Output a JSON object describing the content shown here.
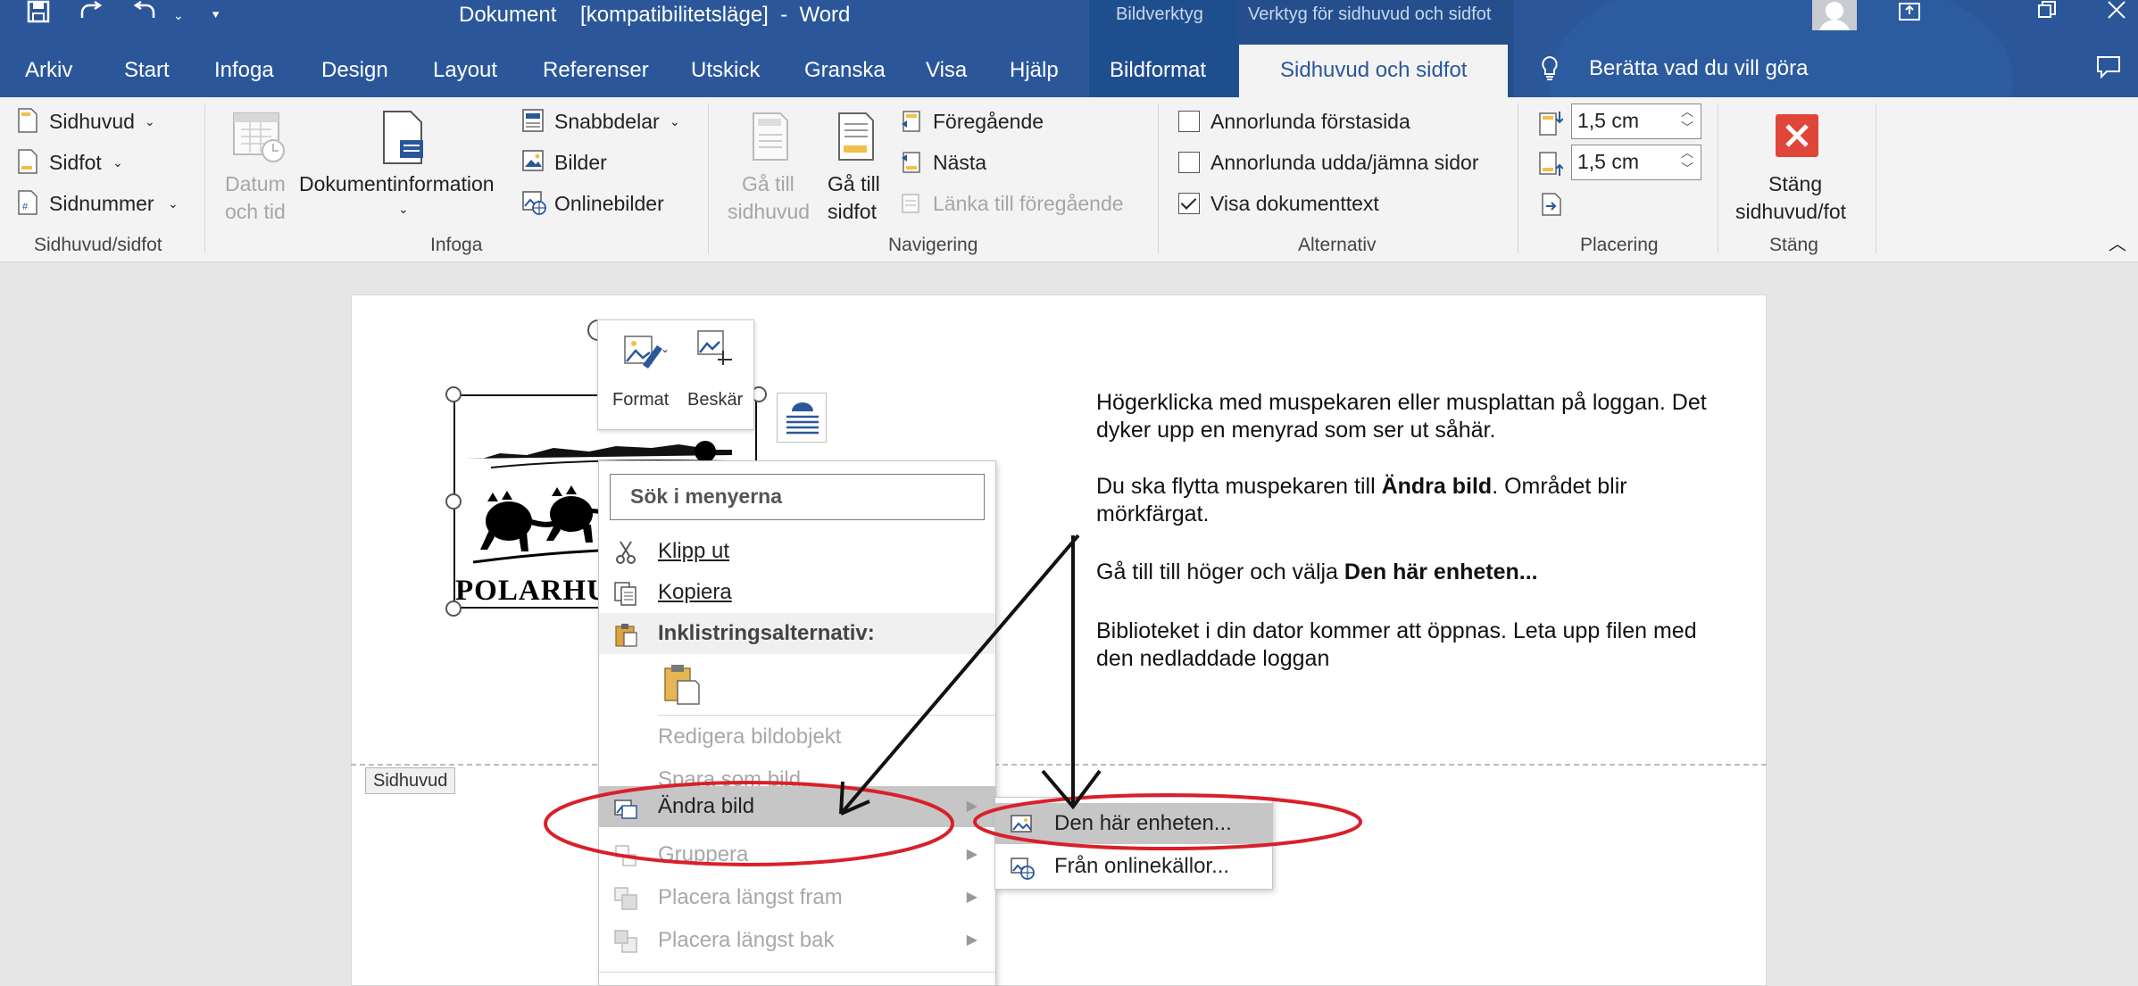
{
  "title_bar": {
    "document_title": "Dokument    [kompatibilitetsläge]  -  Word",
    "context_groups": [
      "Bildverktyg",
      "Verktyg för sidhuvud och sidfot"
    ]
  },
  "tabs": [
    "Arkiv",
    "Start",
    "Infoga",
    "Design",
    "Layout",
    "Referenser",
    "Utskick",
    "Granska",
    "Visa",
    "Hjälp",
    "Bildformat",
    "Sidhuvud och sidfot"
  ],
  "tell_me": "Berätta vad du vill göra",
  "ribbon": {
    "groups": {
      "header_footer": {
        "label": "Sidhuvud/sidfot",
        "items": [
          "Sidhuvud",
          "Sidfot",
          "Sidnummer"
        ]
      },
      "insert": {
        "label": "Infoga",
        "date_time": [
          "Datum",
          "och tid"
        ],
        "doc_info": "Dokumentinformation",
        "quick_parts": "Snabbdelar",
        "pictures": "Bilder",
        "online_pictures": "Onlinebilder"
      },
      "navigation": {
        "label": "Navigering",
        "goto_header": [
          "Gå till",
          "sidhuvud"
        ],
        "goto_footer": [
          "Gå till",
          "sidfot"
        ],
        "previous": "Föregående",
        "next": "Nästa",
        "link_previous": "Länka till föregående"
      },
      "options": {
        "label": "Alternativ",
        "checkboxes": [
          {
            "label": "Annorlunda förstasida",
            "checked": false
          },
          {
            "label": "Annorlunda udda/jämna sidor",
            "checked": false
          },
          {
            "label": "Visa dokumenttext",
            "checked": true
          }
        ]
      },
      "position": {
        "label": "Placering",
        "header_from_top": "1,5 cm",
        "footer_from_bottom": "1,5 cm"
      },
      "close": {
        "label": "Stäng",
        "button": [
          "Stäng",
          "sidhuvud/fot"
        ]
      }
    }
  },
  "mini_toolbar": {
    "format": "Format",
    "crop": "Beskär"
  },
  "logo_text": "POLARHUN",
  "instructions": {
    "p1": "Högerklicka med muspekaren eller musplattan på loggan. Det dyker upp en menyrad som ser ut såhär.",
    "p2_pre": "Du ska flytta muspekaren till ",
    "p2_bold": "Ändra bild",
    "p2_post": ". Området blir mörkfärgat.",
    "p3_pre": "Gå till till höger och välja ",
    "p3_bold": "Den här enheten...",
    "p4": "Biblioteket i din dator kommer att öppnas. Leta upp filen med den nedladdade loggan"
  },
  "header_tag": "Sidhuvud",
  "context_menu": {
    "search_placeholder": "Sök i menyerna",
    "cut": "Klipp ut",
    "copy": "Kopiera",
    "paste_options": "Inklistringsalternativ:",
    "edit_picture": "Redigera bildobjekt",
    "save_as_picture": "Spara som bild...",
    "change_picture": "Ändra bild",
    "group": "Gruppera",
    "bring_front": "Placera längst fram",
    "send_back": "Placera längst bak"
  },
  "submenu": {
    "this_device": "Den här enheten...",
    "online_sources": "Från onlinekällor..."
  },
  "colors": {
    "word_blue": "#2b579a",
    "ribbon_bg": "#f3f3f3",
    "annotation_red": "#d9202a",
    "close_red": "#e0453a"
  }
}
